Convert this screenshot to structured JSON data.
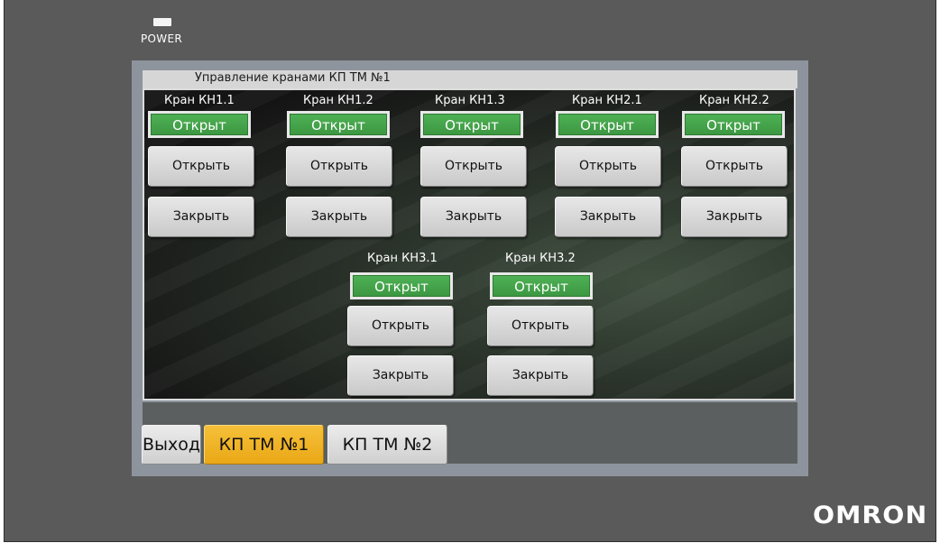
{
  "device": {
    "power_label": "POWER",
    "brand": "OMRON"
  },
  "panel": {
    "title": "Управление кранами КП ТМ №1"
  },
  "valves": [
    {
      "label": "Кран КН1.1",
      "status": "Открыт",
      "open_label": "Открыть",
      "close_label": "Закрыть"
    },
    {
      "label": "Кран КН1.2",
      "status": "Открыт",
      "open_label": "Открыть",
      "close_label": "Закрыть"
    },
    {
      "label": "Кран КН1.3",
      "status": "Открыт",
      "open_label": "Открыть",
      "close_label": "Закрыть"
    },
    {
      "label": "Кран КН2.1",
      "status": "Открыт",
      "open_label": "Открыть",
      "close_label": "Закрыть"
    },
    {
      "label": "Кран КН2.2",
      "status": "Открыт",
      "open_label": "Открыть",
      "close_label": "Закрыть"
    },
    {
      "label": "Кран КН3.1",
      "status": "Открыт",
      "open_label": "Открыть",
      "close_label": "Закрыть"
    },
    {
      "label": "Кран КН3.2",
      "status": "Открыт",
      "open_label": "Открыть",
      "close_label": "Закрыть"
    }
  ],
  "tabs": [
    {
      "label": "Выход",
      "active": false
    },
    {
      "label": "КП ТМ №1",
      "active": true
    },
    {
      "label": "КП ТМ №2",
      "active": false
    }
  ],
  "colors": {
    "status_open": "#46a64c",
    "tab_active": "#f0b429",
    "bezel": "#5a5a5a"
  }
}
